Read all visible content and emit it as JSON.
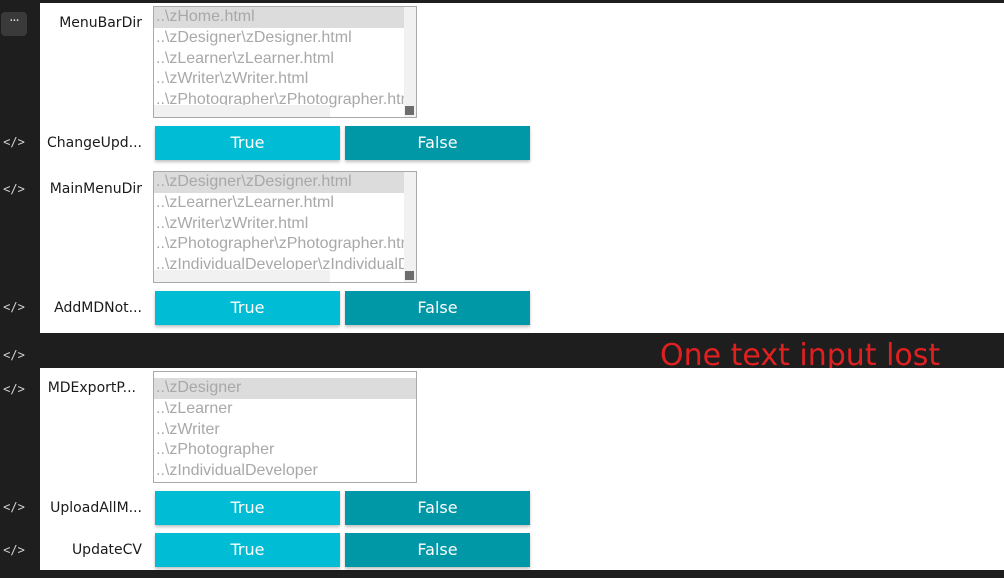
{
  "icons": {
    "menu": "···",
    "code": "</>"
  },
  "fields": {
    "menu_bar_dir": {
      "label": "MenuBarDir",
      "options": [
        "..\\zHome.html",
        "..\\zDesigner\\zDesigner.html",
        "..\\zLearner\\zLearner.html",
        "..\\zWriter\\zWriter.html",
        "..\\zPhotographer\\zPhotographer.html"
      ]
    },
    "change_upd": {
      "label": "ChangeUpd...",
      "true_label": "True",
      "false_label": "False"
    },
    "main_menu_dir": {
      "label": "MainMenuDir",
      "options": [
        "..\\zDesigner\\zDesigner.html",
        "..\\zLearner\\zLearner.html",
        "..\\zWriter\\zWriter.html",
        "..\\zPhotographer\\zPhotographer.html",
        "..\\zIndividualDeveloper\\zIndividualDeveloper.html"
      ]
    },
    "add_md_not": {
      "label": "AddMDNot...",
      "true_label": "True",
      "false_label": "False"
    },
    "md_export_p": {
      "label": "MDExportP...",
      "options": [
        "..\\zDesigner",
        "..\\zLearner",
        "..\\zWriter",
        "..\\zPhotographer",
        "..\\zIndividualDeveloper"
      ]
    },
    "upload_all_m": {
      "label": "UploadAllM...",
      "true_label": "True",
      "false_label": "False"
    },
    "update_cv": {
      "label": "UpdateCV",
      "true_label": "True",
      "false_label": "False"
    }
  },
  "annotation": "One text input lost",
  "colors": {
    "true_button": "#00bcd4",
    "false_button": "#0097a7",
    "annotation": "#e02020",
    "gutter": "#1e1e1e"
  }
}
